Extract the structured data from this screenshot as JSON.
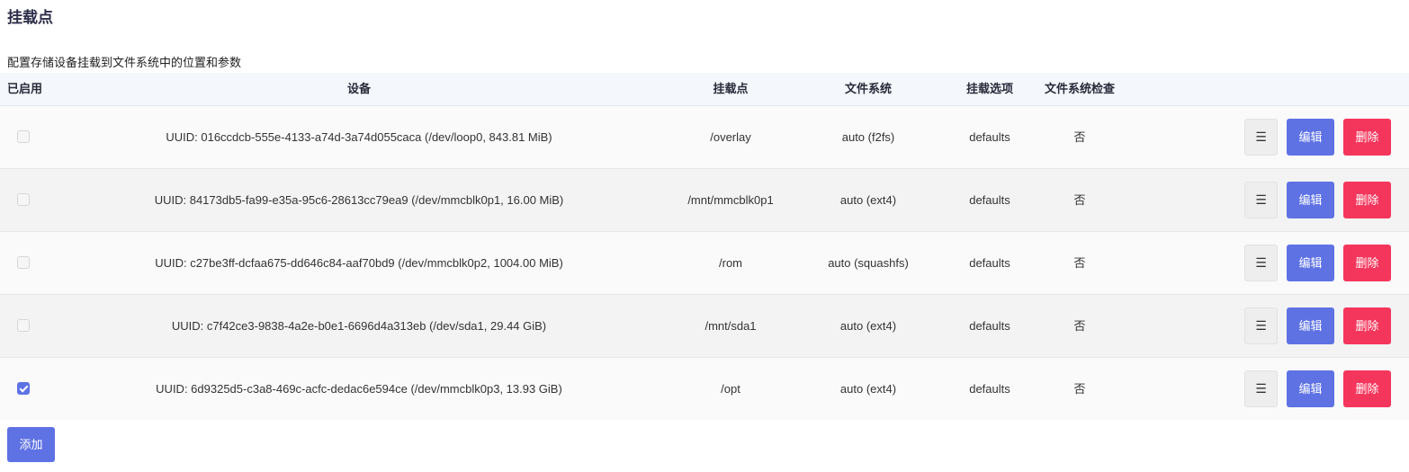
{
  "section": {
    "title": "挂载点",
    "description": "配置存储设备挂载到文件系统中的位置和参数"
  },
  "table": {
    "headers": {
      "enabled": "已启用",
      "device": "设备",
      "mount_point": "挂载点",
      "filesystem": "文件系统",
      "options": "挂载选项",
      "fsck": "文件系统检查"
    },
    "rows": [
      {
        "enabled": false,
        "device": "UUID: 016ccdcb-555e-4133-a74d-3a74d055caca (/dev/loop0, 843.81 MiB)",
        "mount_point": "/overlay",
        "filesystem": "auto (f2fs)",
        "options": "defaults",
        "fsck": "否"
      },
      {
        "enabled": false,
        "device": "UUID: 84173db5-fa99-e35a-95c6-28613cc79ea9 (/dev/mmcblk0p1, 16.00 MiB)",
        "mount_point": "/mnt/mmcblk0p1",
        "filesystem": "auto (ext4)",
        "options": "defaults",
        "fsck": "否"
      },
      {
        "enabled": false,
        "device": "UUID: c27be3ff-dcfaa675-dd646c84-aaf70bd9 (/dev/mmcblk0p2, 1004.00 MiB)",
        "mount_point": "/rom",
        "filesystem": "auto (squashfs)",
        "options": "defaults",
        "fsck": "否"
      },
      {
        "enabled": false,
        "device": "UUID: c7f42ce3-9838-4a2e-b0e1-6696d4a313eb (/dev/sda1, 29.44 GiB)",
        "mount_point": "/mnt/sda1",
        "filesystem": "auto (ext4)",
        "options": "defaults",
        "fsck": "否"
      },
      {
        "enabled": true,
        "device": "UUID: 6d9325d5-c3a8-469c-acfc-dedac6e594ce (/dev/mmcblk0p3, 13.93 GiB)",
        "mount_point": "/opt",
        "filesystem": "auto (ext4)",
        "options": "defaults",
        "fsck": "否"
      }
    ],
    "actions": {
      "menu_icon": "☰",
      "edit_label": "编辑",
      "delete_label": "删除"
    }
  },
  "add_button": {
    "label": "添加"
  },
  "colors": {
    "primary": "#5e72e4",
    "danger": "#f5365c"
  }
}
